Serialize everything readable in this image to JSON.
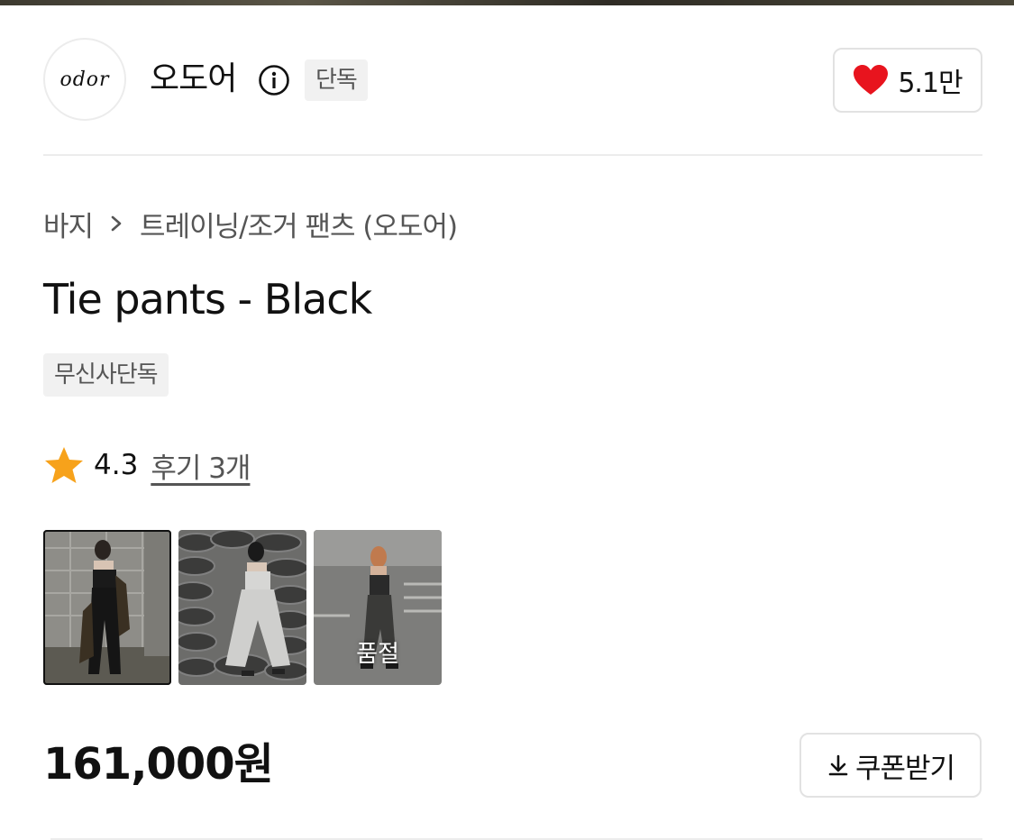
{
  "brand": {
    "logo_text": "odor",
    "name": "오도어",
    "info_icon": "info-circle-icon",
    "badge": "단독"
  },
  "like": {
    "icon": "heart-icon",
    "icon_color": "#e8141e",
    "count": "5.1만"
  },
  "breadcrumb": {
    "category": "바지",
    "separator_icon": "chevron-right-icon",
    "subcategory": "트레이닝/조거 팬츠 (오도어)"
  },
  "product": {
    "title": "Tie pants - Black",
    "tag": "무신사단독"
  },
  "rating": {
    "icon": "star-icon",
    "icon_color": "#f7a21b",
    "value": "4.3",
    "review_link": "후기 3개"
  },
  "color_options": [
    {
      "selected": true,
      "sold_out": false,
      "label": ""
    },
    {
      "selected": false,
      "sold_out": false,
      "label": ""
    },
    {
      "selected": false,
      "sold_out": true,
      "label": "품절"
    }
  ],
  "price": {
    "value": "161,000원"
  },
  "coupon": {
    "icon": "download-icon",
    "label": "쿠폰받기"
  }
}
